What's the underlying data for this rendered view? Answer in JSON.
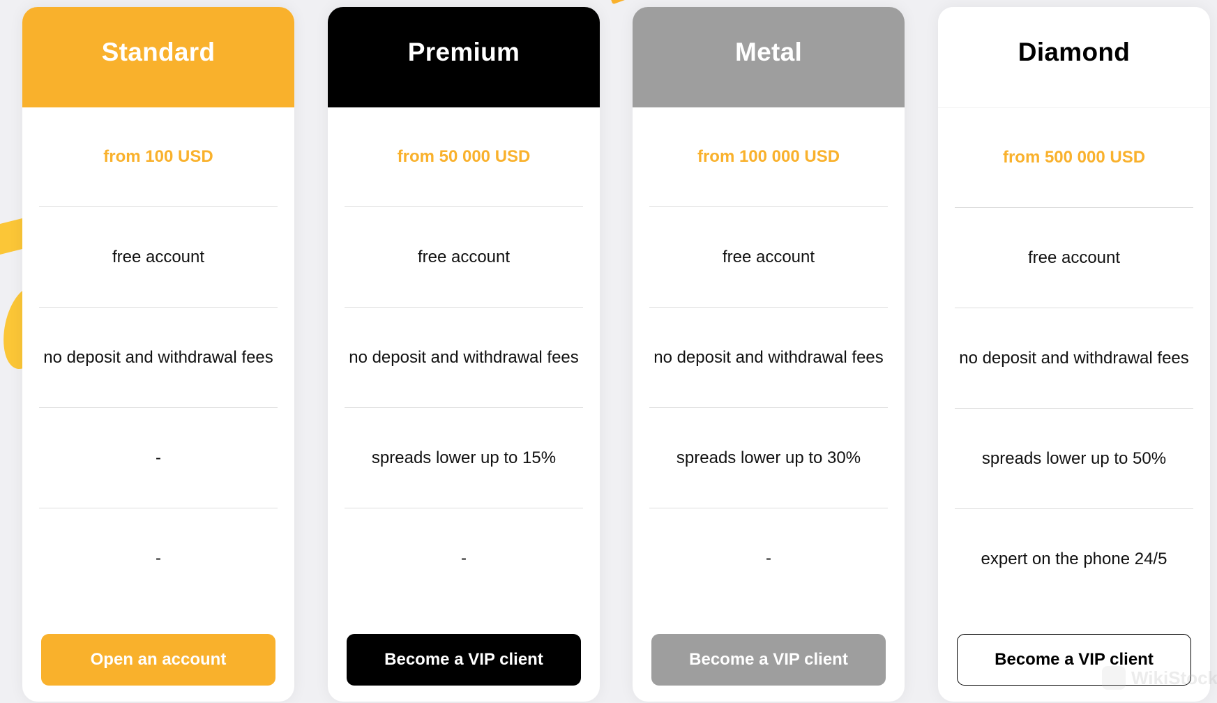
{
  "colors": {
    "page_bg": "#f0f0f3",
    "accent": "#f9b12c",
    "premium": "#000000",
    "metal": "#9e9e9e",
    "diamond": "#ffffff"
  },
  "plans": [
    {
      "name": "Standard",
      "header_bg": "#f9b12c",
      "header_text_color": "#ffffff",
      "price": "from 100 USD",
      "features": [
        "free account",
        "no deposit and withdrawal fees",
        "-",
        "-"
      ],
      "button": {
        "label": "Open an account",
        "bg": "#f9b12c",
        "text_color": "#ffffff",
        "border": "none"
      }
    },
    {
      "name": "Premium",
      "header_bg": "#000000",
      "header_text_color": "#ffffff",
      "price": "from 50 000 USD",
      "features": [
        "free account",
        "no deposit and withdrawal fees",
        "spreads lower up to 15%",
        "-"
      ],
      "button": {
        "label": "Become a VIP client",
        "bg": "#000000",
        "text_color": "#ffffff",
        "border": "none"
      }
    },
    {
      "name": "Metal",
      "header_bg": "#9e9e9e",
      "header_text_color": "#ffffff",
      "price": "from 100 000 USD",
      "features": [
        "free account",
        "no deposit and withdrawal fees",
        "spreads lower up to 30%",
        "-"
      ],
      "button": {
        "label": "Become a VIP client",
        "bg": "#9e9e9e",
        "text_color": "#ffffff",
        "border": "none"
      }
    },
    {
      "name": "Diamond",
      "header_bg": "#ffffff",
      "header_text_color": "#000000",
      "price": "from 500 000 USD",
      "features": [
        "free account",
        "no deposit and withdrawal fees",
        "spreads lower up to 50%",
        "expert on the phone 24/5"
      ],
      "button": {
        "label": "Become a VIP client",
        "bg": "#ffffff",
        "text_color": "#000000",
        "border": "1.5px solid #000000"
      }
    }
  ],
  "watermark": {
    "text": "WikiStock"
  }
}
